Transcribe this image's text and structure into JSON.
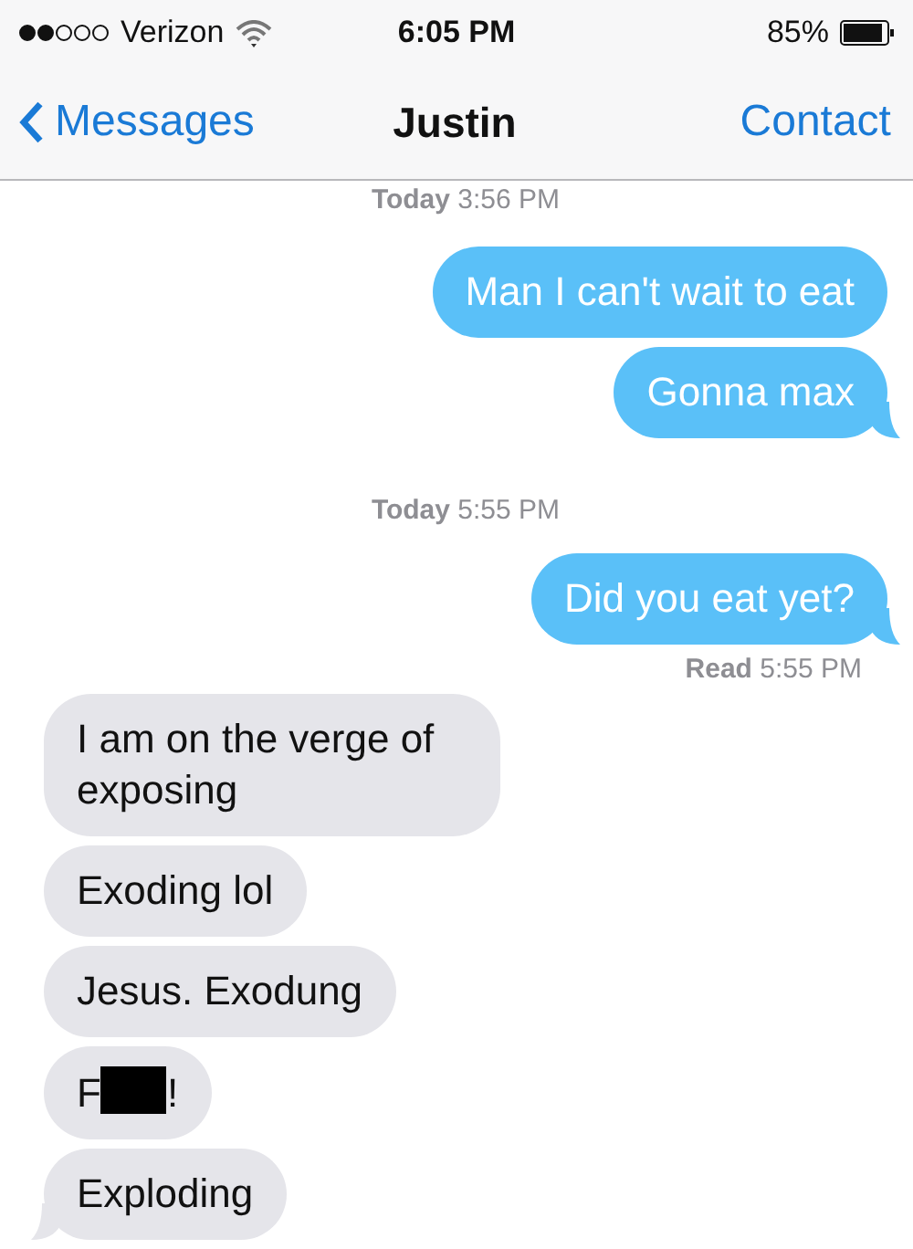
{
  "status_bar": {
    "carrier": "Verizon",
    "time": "6:05 PM",
    "battery": "85%"
  },
  "nav": {
    "back": "Messages",
    "title": "Justin",
    "action": "Contact"
  },
  "messages": [
    {
      "kind": "timestamp",
      "day": "Today",
      "time": "3:56 PM"
    },
    {
      "kind": "bubble",
      "outgoing": true,
      "text": "Man I can't wait to eat",
      "tail": false
    },
    {
      "kind": "bubble",
      "outgoing": true,
      "text": "Gonna max",
      "tail": true
    },
    {
      "kind": "timestamp",
      "day": "Today",
      "time": "5:55 PM"
    },
    {
      "kind": "bubble",
      "outgoing": true,
      "text": "Did you eat yet?",
      "tail": true
    },
    {
      "kind": "receipt",
      "label": "Read",
      "time": "5:55 PM"
    },
    {
      "kind": "bubble",
      "outgoing": false,
      "text": "I am on the verge of exposing",
      "tail": false
    },
    {
      "kind": "bubble",
      "outgoing": false,
      "text": "Exoding lol",
      "tail": false
    },
    {
      "kind": "bubble",
      "outgoing": false,
      "text": "Jesus. Exodung",
      "tail": false
    },
    {
      "kind": "redacted",
      "outgoing": false,
      "before": "F",
      "after": "!",
      "tail": false
    },
    {
      "kind": "bubble",
      "outgoing": false,
      "text": "Exploding",
      "tail": true
    }
  ]
}
